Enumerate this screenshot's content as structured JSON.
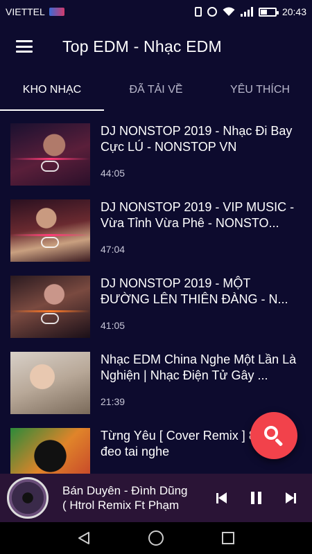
{
  "status_bar": {
    "carrier": "VIETTEL",
    "time": "20:43"
  },
  "header": {
    "title": "Top EDM - Nhạc EDM",
    "menu_icon": "hamburger-menu-icon"
  },
  "tabs": [
    {
      "label": "KHO NHẠC",
      "active": true
    },
    {
      "label": "ĐÃ TẢI VỀ",
      "active": false
    },
    {
      "label": "YÊU THÍCH",
      "active": false
    }
  ],
  "tracks": [
    {
      "title": "DJ NONSTOP 2019 - Nhạc Đi Bay Cực LÚ - NONSTOP VN",
      "duration": "44:05"
    },
    {
      "title": "DJ NONSTOP 2019 - VIP MUSIC - Vừa Tỉnh Vừa Phê - NONSTO...",
      "duration": "47:04"
    },
    {
      "title": "DJ NONSTOP 2019 - MỘT ĐƯỜNG LÊN THIÊN ĐÀNG - N...",
      "duration": "41:05"
    },
    {
      "title": "Nhạc EDM China Nghe Một Lần Là Nghiện | Nhạc Điện Tử Gây ...",
      "duration": "21:39"
    },
    {
      "title": "Từng Yêu [ Cover Remix ] 8d nhớ đeo tai nghe",
      "duration": ""
    }
  ],
  "fab": {
    "icon": "search-icon"
  },
  "player": {
    "line1": "Bán Duyên - Đình Dũng",
    "line2": "( Htrol Remix Ft Phạm"
  },
  "colors": {
    "background": "#0d0b2e",
    "player_bg": "#2a1436",
    "fab": "#f2424b"
  }
}
